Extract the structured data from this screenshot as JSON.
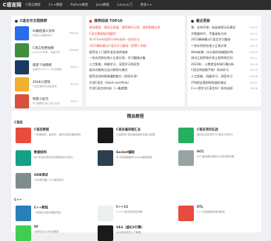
{
  "logo": "C语言网",
  "nav": [
    "C语言教程",
    "C++教程",
    "Python教程",
    "Java教程",
    "Linux入门",
    "更多>>"
  ],
  "rec_panel": {
    "title": "C语言中文网推荐",
    "items": [
      {
        "name": "AI编程通义灵码",
        "desc": "阿里云AI编程助手",
        "count": "950542",
        "color": "#2a6cf0"
      },
      {
        "name": "C语言免费视频",
        "desc": "VIP/SVIP专享，完整可学",
        "count": "220383",
        "color": "#3f8f3f"
      },
      {
        "name": "极客个站网络",
        "desc": "全面学习C/C++/开发指南",
        "count": "64071",
        "color": "#1b3a63"
      },
      {
        "name": "2048小游戏",
        "desc": "C语言编写的益智游戏",
        "count": "62520",
        "color": "#f2b12d"
      },
      {
        "name": "积累小技巧",
        "desc": "学习编程实用小技巧大全",
        "count": "45211",
        "color": "#d94f3d"
      }
    ]
  },
  "top10_panel": {
    "title": "推荐阅读 TOP10",
    "items": [
      {
        "text": "电话看管、通话记录器、搜索聊天记录、搜索数据信息",
        "color": "#e74c3c"
      },
      {
        "text": "C语言零基础学编程？",
        "color": "#e74c3c"
      },
      {
        "text": "关于Flex布局和Grid布局的一些知识点",
        "color": "#e74c3c"
      },
      {
        "text": "2023最新最火C语言学习路线（免费+详细）",
        "color": "#e74c3c"
      },
      {
        "text": "程序员入门程序语言选择指南",
        "color": "#333"
      },
      {
        "text": "一些实用的在线小工具分享，学习编程必备",
        "color": "#333"
      },
      {
        "text": "人工智能、机器学习、深度学习的区别",
        "color": "#333"
      },
      {
        "text": "面向对象常见设计原则与模式",
        "color": "#333"
      },
      {
        "text": "程序员如何提高编程能力（经验分享）",
        "color": "#333"
      },
      {
        "text": "大话C语言（stack overflow）",
        "color": "#333"
      },
      {
        "text": "大话C语言的内存（一看就懂）",
        "color": "#333"
      }
    ]
  },
  "update_panel": {
    "title": "最近更新",
    "items": [
      {
        "text": "我：支持开源，给出来提示及建议",
        "date": "03-12"
      },
      {
        "text": "大数据时代、不要迷失方向",
        "date": "03-12"
      },
      {
        "text": "2023最新最火C语言学习路线",
        "date": "03-11"
      },
      {
        "text": "一些实用的在线小工具分享",
        "date": "03-10"
      },
      {
        "text": "Web前端：什么样的前端是好的",
        "date": "03-09"
      },
      {
        "text": "测试工程师和开发工程师的区别",
        "date": "09-11"
      },
      {
        "text": "2023年，人数就业市场行情分析",
        "date": "09-10"
      },
      {
        "text": "C语言到底能干啥？如何学习",
        "date": "09-09"
      },
      {
        "text": "人工智能、机器学习、深度学习",
        "date": "09-08"
      },
      {
        "text": "IT的职业规划和发展的建议",
        "date": "09-07"
      },
      {
        "text": "C++是学习C语言吗？如何选择",
        "date": "09-06"
      }
    ]
  },
  "section_title": "精品教程",
  "cat_c": "C语言",
  "c_cards": [
    {
      "name": "C语言教程",
      "desc": "一种通用的、高效的、面向过程的编程语言",
      "color": "#e74c3c"
    },
    {
      "name": "C语言编译器汇总",
      "desc": "介绍常用C语言编译器的安装与配置",
      "color": "#1a1a1a"
    },
    {
      "name": "C语言项目实战",
      "desc": "通过实战项目学习C语言开发技巧",
      "color": "#27ae60"
    },
    {
      "name": "数据结构",
      "desc": "用C语言实现常见的数据结构与算法",
      "color": "#16a085"
    },
    {
      "name": "Socket编程",
      "desc": "学习网络编程和Socket通信原理",
      "color": "#2c3e50"
    },
    {
      "name": "GCC",
      "desc": "GCC编译器的使用方法和参数详解",
      "color": "#95a5a6"
    },
    {
      "name": "GDB调试",
      "desc": "GDB调试器入门与使用技巧",
      "color": "#7f8c8d"
    }
  ],
  "cat_cpp": "C++",
  "cpp_cards": [
    {
      "name": "C++教程",
      "desc": "一种面向对象的编程语言",
      "color": "#2980b9"
    },
    {
      "name": "C++11",
      "desc": "C++11新标准特性详解",
      "color": "#ecf0f1"
    },
    {
      "name": "STL",
      "desc": "C++标准模板库使用教程",
      "color": "#e74c3c"
    },
    {
      "name": "Qt",
      "desc": "Qt跨平台GUI开发教程",
      "color": "#41cd52"
    },
    {
      "name": "UE4（虚幻4引擎）",
      "desc": "UE4游戏开发入门教程",
      "color": "#1a1a1a"
    }
  ]
}
